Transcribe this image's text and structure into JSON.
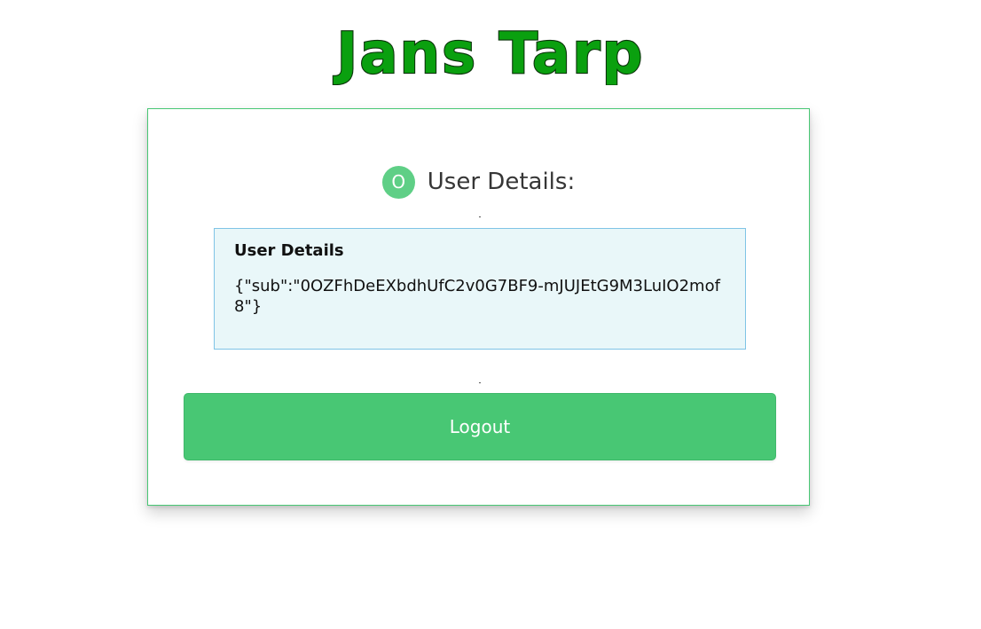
{
  "brand": {
    "logo_text": "Jans Tarp",
    "logo_color": "#0aa00f"
  },
  "card": {
    "avatar_letter": "O",
    "heading": "User Details:",
    "details": {
      "title": "User Details",
      "body": "{\"sub\":\"0OZFhDeEXbdhUfC2v0G7BF9-mJUJEtG9M3LuIO2mof8\"}"
    },
    "logout_label": "Logout"
  },
  "colors": {
    "accent": "#48c774",
    "avatar_bg": "#5fcf86",
    "info_bg": "#e9f7f9",
    "info_border": "#7fc4e6"
  }
}
